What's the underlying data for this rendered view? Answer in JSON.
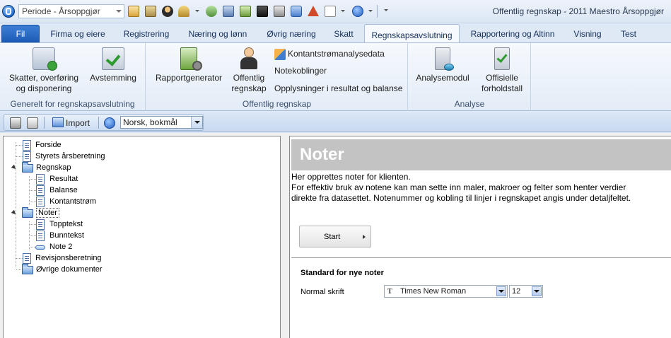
{
  "titlebar": {
    "period": "Periode - Årsoppgjør",
    "window_title": "Offentlig regnskap - 2011 Maestro Årsoppgjør"
  },
  "tabs": {
    "file": "Fil",
    "items": [
      "Firma og eiere",
      "Registrering",
      "Næring og lønn",
      "Øvrig næring",
      "Skatt",
      "Regnskapsavslutning",
      "Rapportering og Altinn",
      "Visning",
      "Test"
    ],
    "active": "Regnskapsavslutning"
  },
  "ribbon": {
    "group1": {
      "label": "Generelt for regnskapsavslutning",
      "btn1_line1": "Skatter, overføring",
      "btn1_line2": "og disponering",
      "btn2": "Avstemming"
    },
    "group2": {
      "label": "Offentlig regnskap",
      "btn1": "Rapportgenerator",
      "btn2_line1": "Offentlig",
      "btn2_line2": "regnskap",
      "small1": "Kontantstrømanalysedata",
      "small2": "Notekoblinger",
      "small3": "Opplysninger i resultat og balanse"
    },
    "group3": {
      "label": "Analyse",
      "btn1": "Analysemodul",
      "btn2_line1": "Offisielle",
      "btn2_line2": "forholdstall"
    }
  },
  "toolbar": {
    "import_label": "Import",
    "language": "Norsk, bokmål"
  },
  "tree": {
    "forside": "Forside",
    "styrets": "Styrets årsberetning",
    "regnskap": "Regnskap",
    "resultat": "Resultat",
    "balanse": "Balanse",
    "kontantstrom": "Kontantstrøm",
    "noter": "Noter",
    "topptekst": "Topptekst",
    "bunntekst": "Bunntekst",
    "note2": "Note 2",
    "revisjon": "Revisjonsberetning",
    "ovrige": "Øvrige dokumenter"
  },
  "detail": {
    "title": "Noter",
    "intro_line1": "Her opprettes noter for klienten.",
    "intro_line2": "For effektiv bruk av notene kan man sette inn maler, makroer og felter som henter verdier",
    "intro_line3": "direkte fra datasettet. Notenummer og kobling til linjer i regnskapet angis under detaljfeltet.",
    "start_label": "Start",
    "standard_heading": "Standard for nye noter",
    "font_label": "Normal skrift",
    "font_value": "Times New Roman",
    "size_value": "12"
  },
  "colors": {
    "accent": "#1d5cb6",
    "ribbon_bg": "#e3ecf7",
    "header_gray": "#c3c3c3"
  }
}
